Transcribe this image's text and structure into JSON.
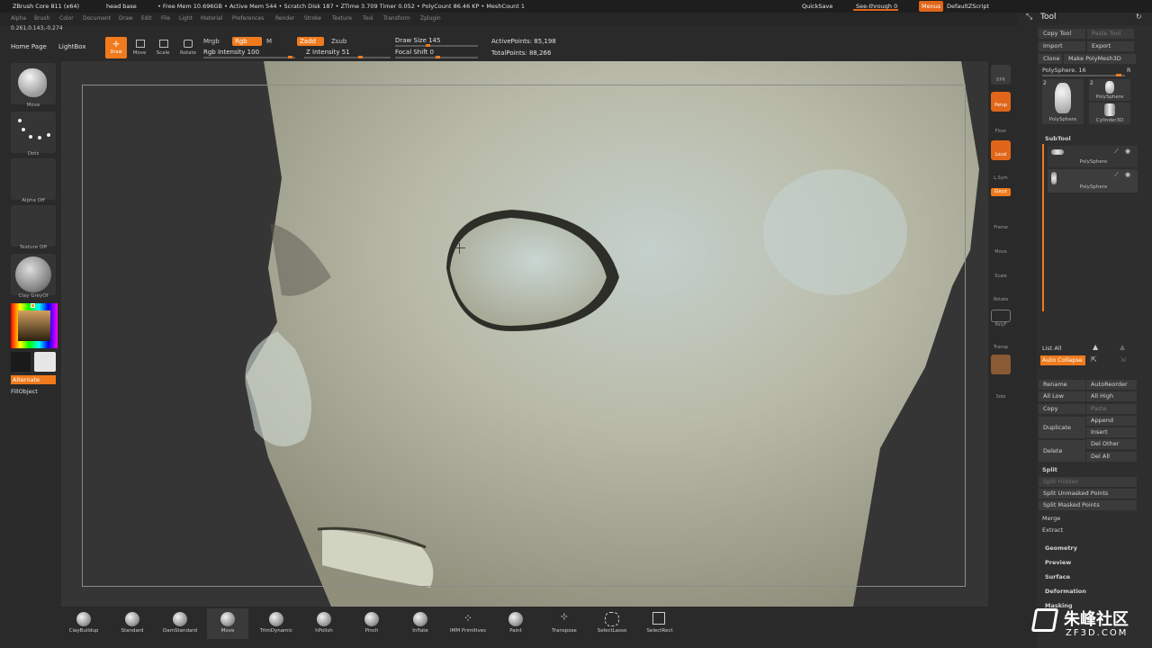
{
  "title_bar": {
    "app": "ZBrush Core 811 (x64)",
    "doc": "head base",
    "stats": "• Free Mem 10.696GB • Active Mem 544 • Scratch Disk 187 • ZTime 3.709 Timer 0.052 • PolyCount 86.46 KP • MeshCount 1",
    "quicksave": "QuickSave",
    "seethrough": "See-through 0",
    "menus": "Menus",
    "script": "DefaultZScript"
  },
  "menu_bar": [
    "Alpha",
    "Brush",
    "Color",
    "Document",
    "Draw",
    "Edit",
    "File",
    "Light",
    "Material",
    "Preferences",
    "Render",
    "Stroke",
    "Texture",
    "Tool",
    "Transform",
    "Zplugin"
  ],
  "coords": "0.261,0.143,-0.274",
  "top_toolbar": {
    "home": "Home Page",
    "lightbox": "LightBox",
    "draw": "Draw",
    "move": "Move",
    "scale": "Scale",
    "rotate": "Rotate",
    "mrgb": "Mrgb",
    "rgb": "Rgb",
    "m": "M",
    "rgb_intensity": "Rgb Intensity 100",
    "zadd": "Zadd",
    "zsub": "Zsub",
    "z_intensity": "Z Intensity 51",
    "draw_size": "Draw Size 145",
    "focal_shift": "Focal Shift 0",
    "active_points": "ActivePoints: 85,198",
    "total_points": "TotalPoints: 88,266"
  },
  "left_shelf": {
    "move": "Move",
    "dots": "Dots",
    "alpha_off": "Alpha Off",
    "texture_off": "Texture Off",
    "material": "Clay GreyOf",
    "alternate": "Alternate",
    "fillobject": "FillObject"
  },
  "right_bar": [
    "BPR",
    "Persp",
    "Floor",
    "Local",
    "L.Sym",
    "Gxyz",
    "Frame",
    "Move",
    "Scale",
    "Rotate",
    "PolyF",
    "Transp",
    "Solo"
  ],
  "tool_panel": {
    "title": "Tool",
    "copy_tool": "Copy Tool",
    "paste_tool": "Paste Tool",
    "import": "Import",
    "export": "Export",
    "clone": "Clone",
    "make_polymesh": "Make PolyMesh3D",
    "polysphere_label": "PolySphere. 16",
    "r": "R",
    "thumb1_num": "2",
    "thumb2_num": "2",
    "thumb1_name": "PolySphere",
    "thumb2_name": "PolySphere",
    "thumb3_name": "Cylinder3D",
    "subtool": "SubTool",
    "subtool1": "PolySphere",
    "subtool2": "PolySphere",
    "list_all": "List All",
    "auto_collapse": "Auto Collapse",
    "rename": "Rename",
    "autoreorder": "AutoReorder",
    "all_low": "All Low",
    "all_high": "All High",
    "copy": "Copy",
    "paste": "Paste",
    "duplicate": "Duplicate",
    "append": "Append",
    "insert": "Insert",
    "delete": "Delete",
    "del_other": "Del Other",
    "del_all": "Del All",
    "split": "Split",
    "split_hidden": "Split Hidden",
    "split_unmasked": "Split Unmasked Points",
    "split_masked": "Split Masked Points",
    "merge": "Merge",
    "extract": "Extract",
    "geometry": "Geometry",
    "preview": "Preview",
    "surface": "Surface",
    "deformation": "Deformation",
    "masking": "Masking"
  },
  "bottom_brushes": [
    "ClayBuildup",
    "Standard",
    "DamStandard",
    "Move",
    "TrimDynamic",
    "hPolish",
    "Pinch",
    "Inflate",
    "IMM Primitives",
    "Paint",
    "Transpose",
    "SelectLasso",
    "SelectRect"
  ],
  "watermark": {
    "cn": "朱峰社区",
    "url": "ZF3D.COM"
  }
}
